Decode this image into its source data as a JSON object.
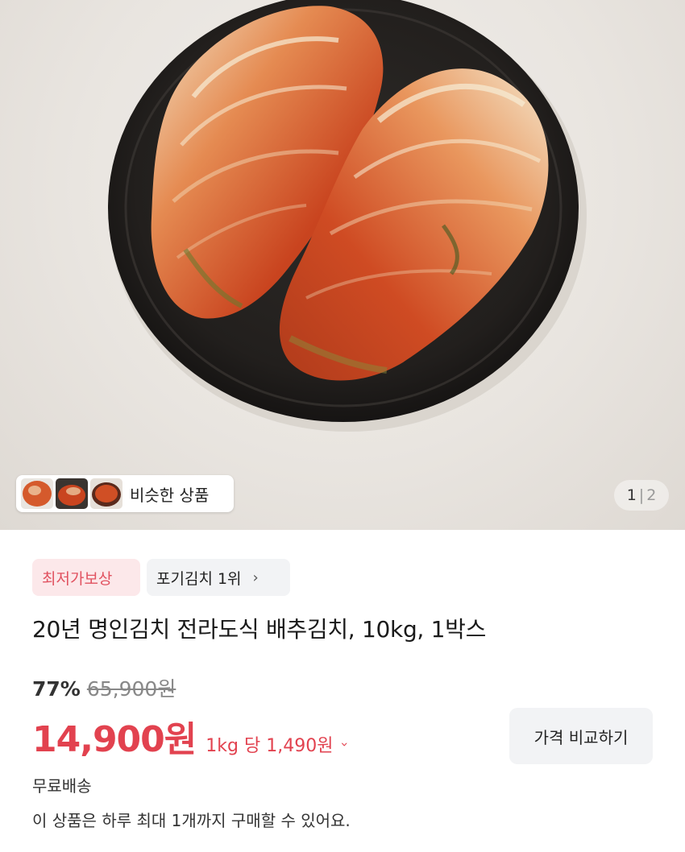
{
  "similar_products": {
    "label": "비슷한 상품"
  },
  "pager": {
    "current": "1",
    "separator": "|",
    "total": "2"
  },
  "badges": {
    "sale": "최저가보상",
    "rank": "포기김치 1위",
    "rank_chevron": "chevron-right-icon"
  },
  "product": {
    "title": "20년 명인김치 전라도식 배추김치, 10kg, 1박스",
    "discount_rate": "77%",
    "original_price": "65,900원",
    "price": "14,900원",
    "unit_price": "1kg 당 1,490원",
    "shipping": "무료배송",
    "purchase_limit": "이 상품은 하루 최대 1개까지 구매할 수 있어요."
  },
  "actions": {
    "compare_label": "가격 비교하기"
  },
  "colors": {
    "accent_red": "#e2424f",
    "sale_badge_bg": "#fce8ea",
    "chip_bg": "#f2f3f5"
  }
}
